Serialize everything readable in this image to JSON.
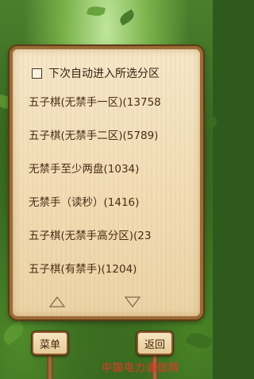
{
  "panel": {
    "auto_checkbox_label": "下次自动进入所选分区",
    "auto_checked": false,
    "rooms": [
      "五子棋(无禁手一区)(13758",
      "五子棋(无禁手二区)(5789)",
      "无禁手至少两盘(1034)",
      "无禁手（读秒）(1416)",
      "五子棋(无禁手高分区)(23",
      "五子棋(有禁手)(1204)"
    ]
  },
  "footer": {
    "menu_label": "菜单",
    "back_label": "返回"
  },
  "watermark": "中国电力通信网",
  "colors": {
    "panel_bg": "#f1dcb4",
    "panel_border": "#9c6b35",
    "text": "#4a2c16",
    "watermark": "#dc3c28"
  },
  "icons": [
    "checkbox-icon",
    "scroll-up-arrow-icon",
    "scroll-down-arrow-icon"
  ]
}
